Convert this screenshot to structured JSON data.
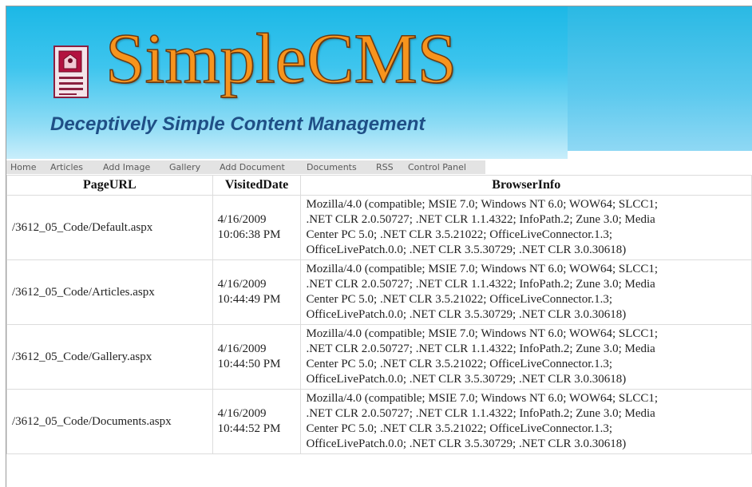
{
  "header": {
    "title": "SimpleCMS",
    "tagline": "Deceptively Simple Content Management",
    "colors": {
      "banner": "#3ec5ee",
      "title": "#f7941d",
      "tagline": "#1f4f86"
    }
  },
  "nav": {
    "items": [
      "Home",
      "Articles",
      "Add Image",
      "Gallery",
      "Add Document",
      "Documents",
      "RSS",
      "Control Panel"
    ]
  },
  "table": {
    "headers": [
      "PageURL",
      "VisitedDate",
      "BrowserInfo"
    ],
    "rows": [
      {
        "url": "/3612_05_Code/Default.aspx",
        "date_line1": "4/16/2009",
        "date_line2": "10:06:38 PM",
        "info_lines": [
          "Mozilla/4.0 (compatible; MSIE 7.0; Windows NT 6.0; WOW64; SLCC1;",
          ".NET CLR 2.0.50727; .NET CLR 1.1.4322; InfoPath.2; Zune 3.0; Media",
          "Center PC 5.0; .NET CLR 3.5.21022; OfficeLiveConnector.1.3;",
          "OfficeLivePatch.0.0; .NET CLR 3.5.30729; .NET CLR 3.0.30618)"
        ]
      },
      {
        "url": "/3612_05_Code/Articles.aspx",
        "date_line1": "4/16/2009",
        "date_line2": "10:44:49 PM",
        "info_lines": [
          "Mozilla/4.0 (compatible; MSIE 7.0; Windows NT 6.0; WOW64; SLCC1;",
          ".NET CLR 2.0.50727; .NET CLR 1.1.4322; InfoPath.2; Zune 3.0; Media",
          "Center PC 5.0; .NET CLR 3.5.21022; OfficeLiveConnector.1.3;",
          "OfficeLivePatch.0.0; .NET CLR 3.5.30729; .NET CLR 3.0.30618)"
        ]
      },
      {
        "url": "/3612_05_Code/Gallery.aspx",
        "date_line1": "4/16/2009",
        "date_line2": "10:44:50 PM",
        "info_lines": [
          "Mozilla/4.0 (compatible; MSIE 7.0; Windows NT 6.0; WOW64; SLCC1;",
          ".NET CLR 2.0.50727; .NET CLR 1.1.4322; InfoPath.2; Zune 3.0; Media",
          "Center PC 5.0; .NET CLR 3.5.21022; OfficeLiveConnector.1.3;",
          "OfficeLivePatch.0.0; .NET CLR 3.5.30729; .NET CLR 3.0.30618)"
        ]
      },
      {
        "url": "/3612_05_Code/Documents.aspx",
        "date_line1": "4/16/2009",
        "date_line2": "10:44:52 PM",
        "info_lines": [
          "Mozilla/4.0 (compatible; MSIE 7.0; Windows NT 6.0; WOW64; SLCC1;",
          ".NET CLR 2.0.50727; .NET CLR 1.1.4322; InfoPath.2; Zune 3.0; Media",
          "Center PC 5.0; .NET CLR 3.5.21022; OfficeLiveConnector.1.3;",
          "OfficeLivePatch.0.0; .NET CLR 3.5.30729; .NET CLR 3.0.30618)"
        ]
      }
    ]
  }
}
